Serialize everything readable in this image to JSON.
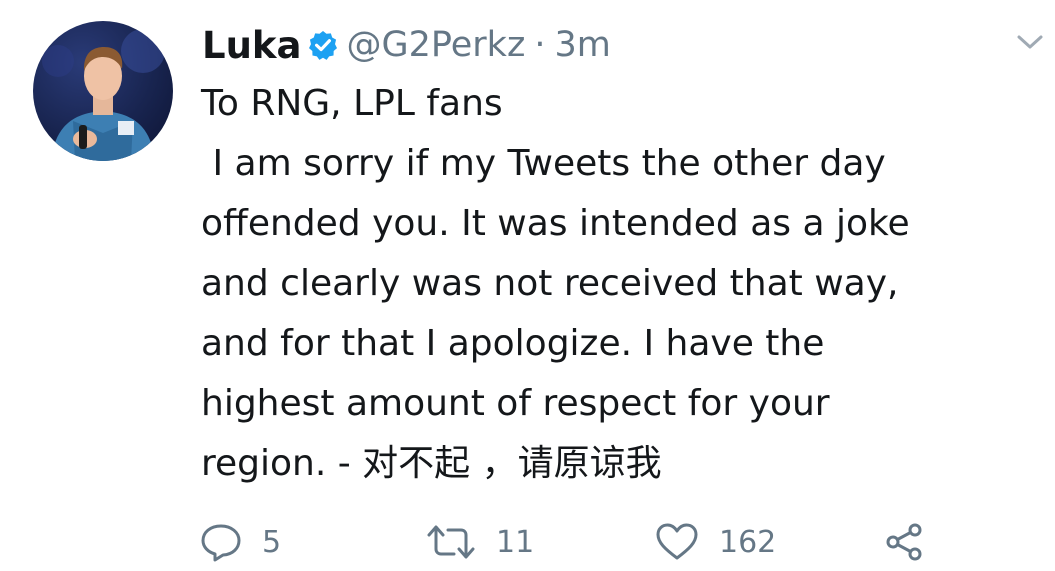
{
  "user": {
    "name": "Luka",
    "handle": "@G2Perkz",
    "separator": "·",
    "time": "3m"
  },
  "tweet": {
    "lines": [
      "To RNG, LPL fans",
      " I am sorry if my Tweets the other day",
      "offended you. It was intended as a joke",
      "and clearly was not received that way,",
      "and for that I apologize. I have the",
      "highest amount of respect for your",
      "region. - 对不起 ，请原谅我"
    ]
  },
  "actions": {
    "replies": "5",
    "retweets": "11",
    "likes": "162"
  },
  "colors": {
    "text": "#14171a",
    "muted": "#657786",
    "verified": "#1da1f2"
  },
  "icons": {
    "verified": "verified-badge-icon",
    "caret": "chevron-down-icon",
    "reply": "reply-icon",
    "retweet": "retweet-icon",
    "like": "heart-icon",
    "share": "share-icon"
  }
}
